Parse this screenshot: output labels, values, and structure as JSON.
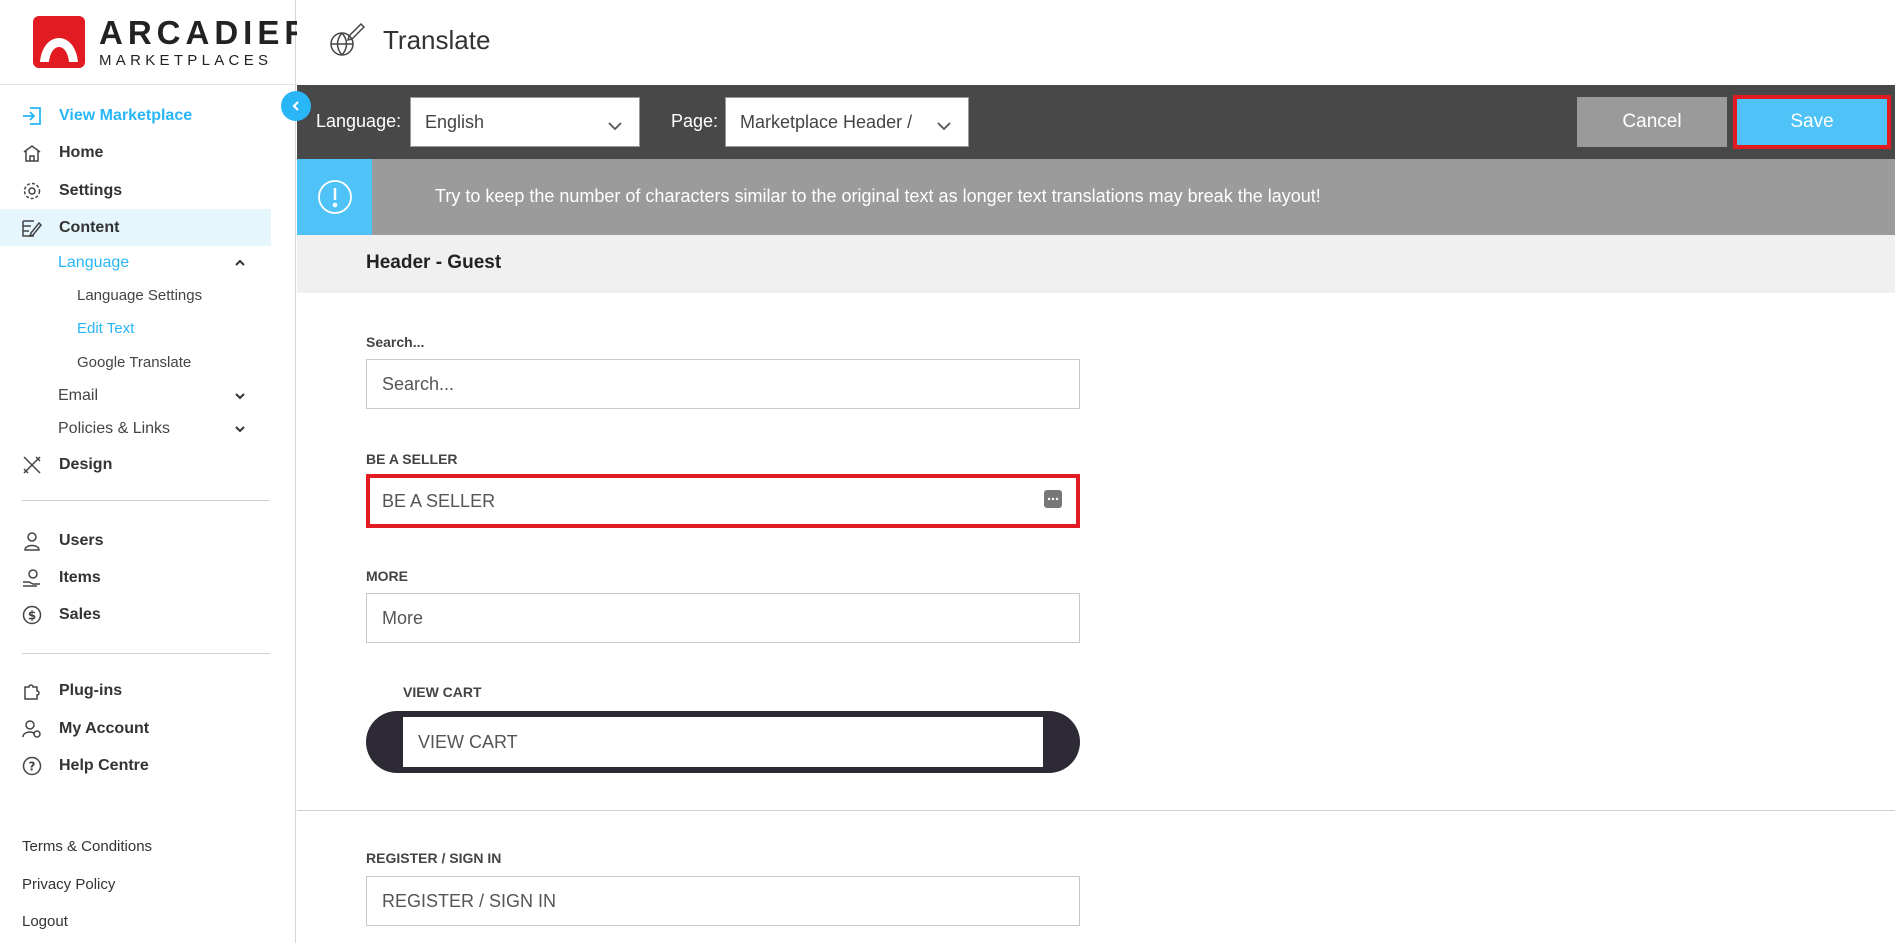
{
  "brand": {
    "name": "ARCADIER",
    "tagline": "MARKETPLACES",
    "color": "#e21b23"
  },
  "sidebar": {
    "items": [
      {
        "label": "View Marketplace",
        "icon": "sign-in-icon"
      },
      {
        "label": "Home",
        "icon": "home-icon"
      },
      {
        "label": "Settings",
        "icon": "gear-icon"
      },
      {
        "label": "Content",
        "icon": "content-edit-icon"
      },
      {
        "label": "Design",
        "icon": "design-tools-icon"
      },
      {
        "label": "Users",
        "icon": "user-icon"
      },
      {
        "label": "Items",
        "icon": "hand-item-icon"
      },
      {
        "label": "Sales",
        "icon": "dollar-icon"
      },
      {
        "label": "Plug-ins",
        "icon": "puzzle-icon"
      },
      {
        "label": "My Account",
        "icon": "user-gear-icon"
      },
      {
        "label": "Help Centre",
        "icon": "help-icon"
      }
    ],
    "content_sub": {
      "language": "Language",
      "language_children": [
        "Language Settings",
        "Edit Text",
        "Google Translate"
      ],
      "email": "Email",
      "policies": "Policies & Links"
    },
    "footer": [
      "Terms & Conditions",
      "Privacy Policy",
      "Logout"
    ]
  },
  "header": {
    "title": "Translate"
  },
  "toolbar": {
    "language_label": "Language:",
    "language_value": "English",
    "page_label": "Page:",
    "page_value": "Marketplace Header /",
    "cancel": "Cancel",
    "save": "Save"
  },
  "notice": {
    "text": "Try to keep the number of characters similar to the original text as longer text translations may break the layout!"
  },
  "section": {
    "title": "Header - Guest"
  },
  "fields": [
    {
      "label": "Search...",
      "value": "Search..."
    },
    {
      "label": "BE A SELLER",
      "value": "BE A SELLER"
    },
    {
      "label": "MORE",
      "value": "More"
    },
    {
      "label": "VIEW CART",
      "value": "VIEW CART"
    },
    {
      "label": "REGISTER / SIGN IN",
      "value": "REGISTER / SIGN IN"
    }
  ],
  "colors": {
    "accent": "#29b6f6",
    "toolbar": "#484848",
    "highlight": "#e21b23"
  }
}
